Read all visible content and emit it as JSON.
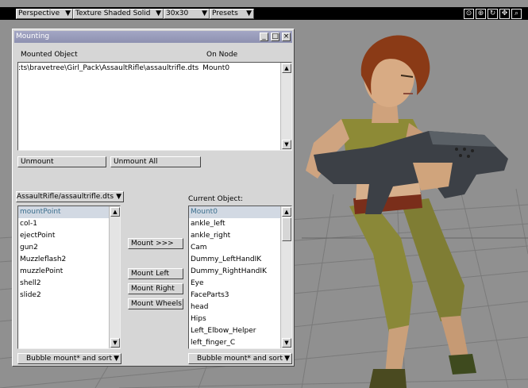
{
  "toolbar": {
    "view_mode": "Perspective",
    "render_mode": "Texture Shaded Solid",
    "grid_size": "30x30",
    "presets": "Presets",
    "icons": [
      "target-icon",
      "grid-icon",
      "rotate-icon",
      "move-icon",
      "zoom-icon"
    ]
  },
  "dialog": {
    "title": "Mounting",
    "mounted_header": "Mounted Object",
    "on_node_header": "On Node",
    "mounted_rows": [
      {
        "object": ":ts\\bravetree\\Girl_Pack\\AssaultRifle\\assaultrifle.dts",
        "node": "Mount0"
      }
    ],
    "unmount_label": "Unmount",
    "unmount_all_label": "Unmount All",
    "source_select": "AssaultRifle/assaultrifle.dts",
    "current_object_label": "Current Object:",
    "source_nodes": [
      "mountPoint",
      "col-1",
      "ejectPoint",
      "gun2",
      "Muzzleflash2",
      "muzzlePoint",
      "shell2",
      "slide2"
    ],
    "target_nodes": [
      "Mount0",
      "ankle_left",
      "ankle_right",
      "Cam",
      "Dummy_LeftHandIK",
      "Dummy_RightHandIK",
      "Eye",
      "FaceParts3",
      "head",
      "Hips",
      "Left_Elbow_Helper",
      "left_finger_C"
    ],
    "mount_button": "Mount >>>",
    "mount_left_button": "Mount Left",
    "mount_right_button": "Mount Right",
    "mount_wheels_button": "Mount Wheels",
    "sort_left": "Bubble mount* and sort",
    "sort_right": "Bubble mount* and sort"
  }
}
